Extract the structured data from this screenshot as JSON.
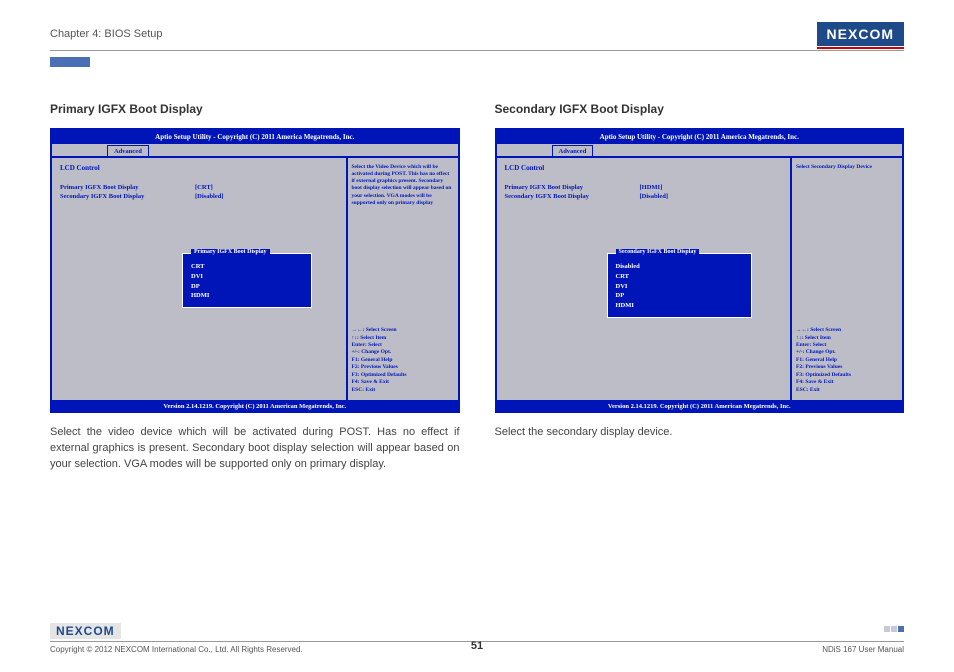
{
  "header": {
    "chapter": "Chapter 4: BIOS Setup",
    "logo": "NEXCOM"
  },
  "left": {
    "title": "Primary IGFX Boot Display",
    "bios": {
      "top": "Aptio Setup Utility - Copyright (C) 2011 America Megatrends, Inc.",
      "tab": "Advanced",
      "lcd": "LCD Control",
      "row1_name": "Primary IGFX Boot Display",
      "row1_val": "[CRT]",
      "row2_name": "Secondary IGFX Boot Display",
      "row2_val": "[Disabled]",
      "help": "Select the Video Device which will be activated during POST. This has no effect if external graphics present. Secondary boot display selection will appear based on your selection. VGA modes will be supported only on primary display",
      "popup_title": "Primary IGFX Boot Display",
      "popup_items": [
        "CRT",
        "DVI",
        "DP",
        "HDMI"
      ],
      "keys": "→←: Select Screen\n↑↓: Select Item\nEnter: Select\n+/-: Change Opt.\nF1: General Help\nF2: Previous Values\nF3: Optimized Defaults\nF4: Save & Exit\nESC: Exit",
      "footer": "Version 2.14.1219. Copyright (C) 2011 American Megatrends, Inc."
    },
    "body": "Select the video device which will be activated during POST. Has no effect if external graphics is present. Secondary boot display selection will appear based on your selection. VGA modes will be supported only on primary display."
  },
  "right": {
    "title": "Secondary IGFX Boot Display",
    "bios": {
      "top": "Aptio Setup Utility - Copyright (C) 2011 America Megatrends, Inc.",
      "tab": "Advanced",
      "lcd": "LCD Control",
      "row1_name": "Primary IGFX Boot Display",
      "row1_val": "[HDMI]",
      "row2_name": "Secondary IGFX Boot Display",
      "row2_val": "[Disabled]",
      "help": "Select Secondary Display Device",
      "popup_title": "Secondary IGFX Boot Display",
      "popup_items": [
        "Disabled",
        "CRT",
        "DVI",
        "DP",
        "HDMI"
      ],
      "keys": "→←: Select Screen\n↑↓: Select Item\nEnter: Select\n+/-: Change Opt.\nF1: General Help\nF2: Previous Values\nF3: Optimized Defaults\nF4: Save & Exit\nESC: Exit",
      "footer": "Version 2.14.1219. Copyright (C) 2011 American Megatrends, Inc."
    },
    "body": "Select the secondary display device."
  },
  "footer": {
    "logo": "NEXCOM",
    "copyright": "Copyright © 2012 NEXCOM International Co., Ltd. All Rights Reserved.",
    "page": "51",
    "manual": "NDiS 167 User Manual"
  }
}
